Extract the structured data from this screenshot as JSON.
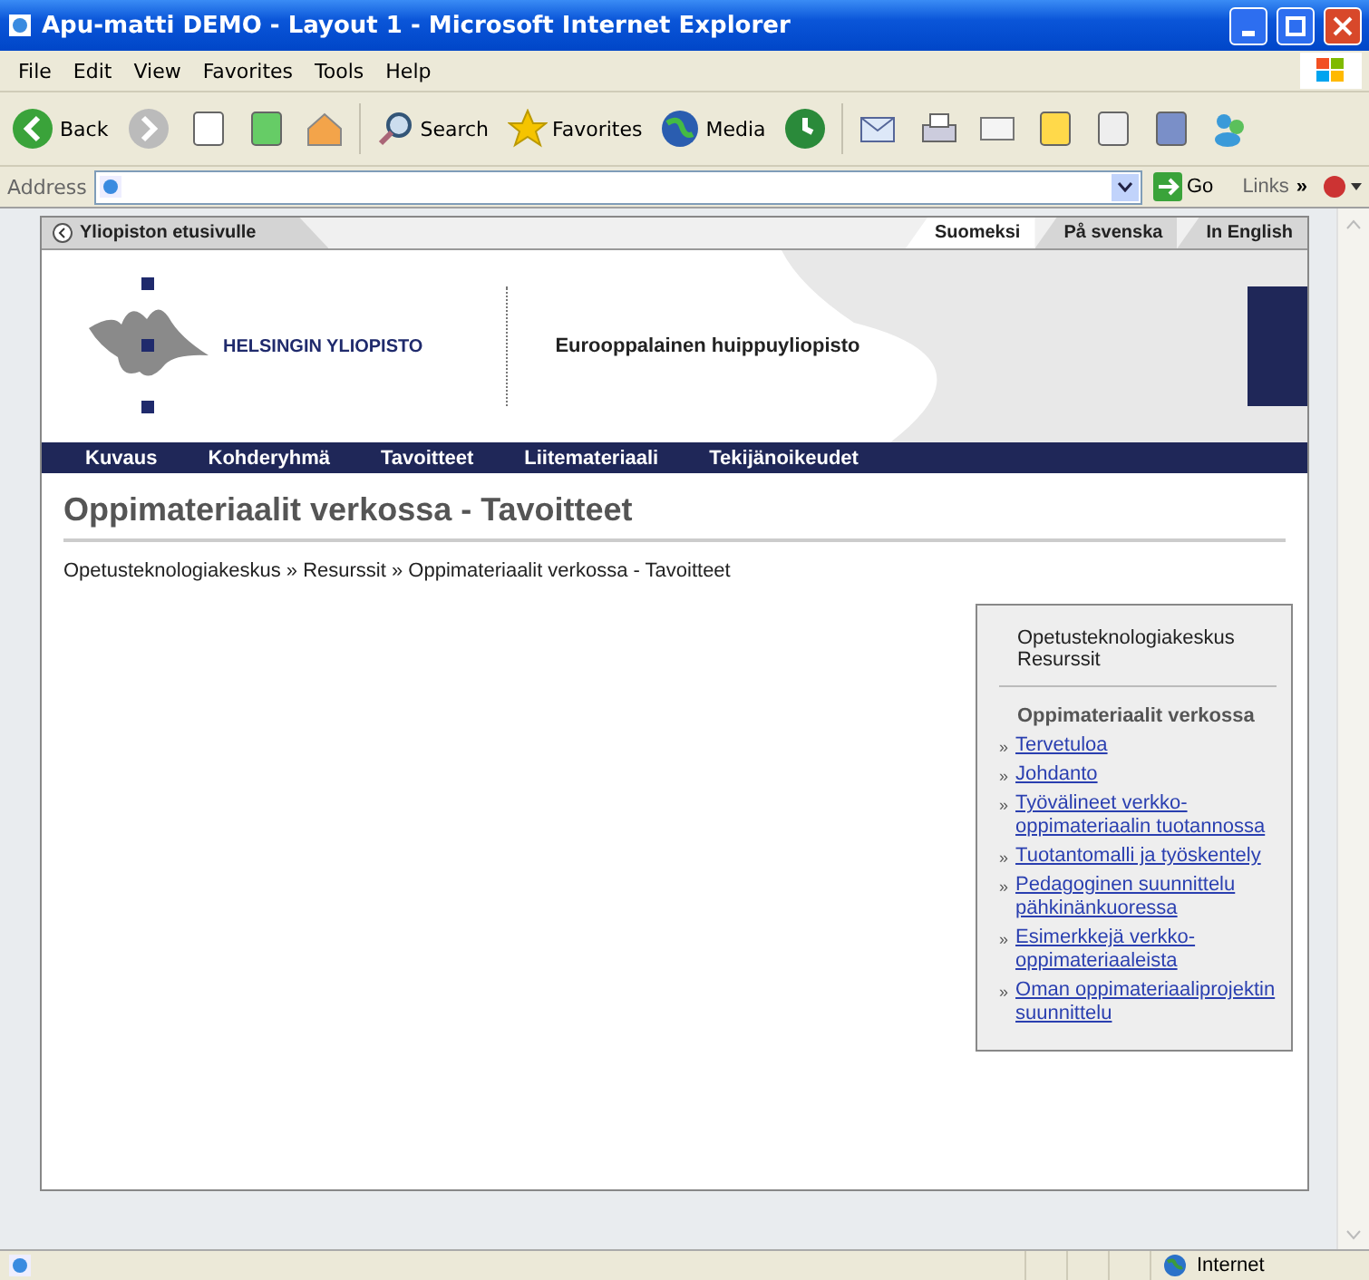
{
  "window": {
    "title": "Apu-matti DEMO - Layout 1 - Microsoft Internet Explorer"
  },
  "menu": [
    "File",
    "Edit",
    "View",
    "Favorites",
    "Tools",
    "Help"
  ],
  "toolbar": {
    "back": "Back",
    "search": "Search",
    "favorites": "Favorites",
    "media": "Media"
  },
  "address_bar": {
    "label": "Address",
    "go": "Go",
    "links": "Links",
    "more": "»"
  },
  "page": {
    "home_link": "Yliopiston etusivulle",
    "languages": [
      {
        "label": "Suomeksi",
        "selected": true
      },
      {
        "label": "På svenska",
        "selected": false
      },
      {
        "label": "In English",
        "selected": false
      }
    ],
    "logo_text": "HELSINGIN YLIOPISTO",
    "slogan": "Eurooppalainen huippuyliopisto",
    "nav": [
      "Kuvaus",
      "Kohderyhmä",
      "Tavoitteet",
      "Liitemateriaali",
      "Tekijänoikeudet"
    ],
    "heading": "Oppimateriaalit verkossa - Tavoitteet",
    "breadcrumb": "Opetusteknologiakeskus » Resurssit » Oppimateriaalit verkossa - Tavoitteet",
    "sidebar": {
      "top_links": [
        "Opetusteknologiakeskus",
        "Resurssit"
      ],
      "section_title": "Oppimateriaalit verkossa",
      "links": [
        {
          "marker": "»",
          "label": "Tervetuloa"
        },
        {
          "marker": "»",
          "label": "Johdanto"
        },
        {
          "marker": "»",
          "label": "Työvälineet verkko-oppimateriaalin tuotannossa"
        },
        {
          "marker": "»",
          "label": "Tuotantomalli ja työskentely"
        },
        {
          "marker": "»",
          "label": "Pedagoginen suunnittelu pähkinänkuoressa"
        },
        {
          "marker": "»",
          "label": "Esimerkkejä verkko-oppimateriaaleista"
        },
        {
          "marker": "»",
          "label": "Oman oppimateriaaliprojektin suunnittelu"
        }
      ]
    }
  },
  "status_bar": {
    "zone": "Internet"
  }
}
